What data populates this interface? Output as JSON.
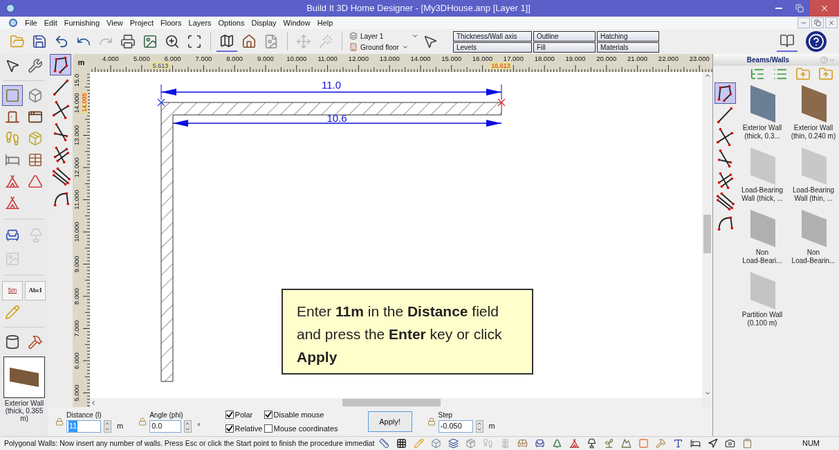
{
  "window": {
    "title": "Build It 3D Home Designer - [My3DHouse.anp [Layer 1]]"
  },
  "menu": [
    "File",
    "Edit",
    "Furnishing",
    "View",
    "Project",
    "Floors",
    "Layers",
    "Options",
    "Display",
    "Window",
    "Help"
  ],
  "toolbar": {
    "layer": "Layer 1",
    "floor": "Ground floor",
    "view_buttons": [
      "Thickness/Wall axis",
      "Outline",
      "Hatching",
      "Levels",
      "Fill",
      "Materials"
    ]
  },
  "toolbox": {
    "dimension_label": "5m",
    "text_label": "AbcI",
    "current_item": [
      "Exterior Wall",
      "(thick, 0.365",
      "m)"
    ]
  },
  "draw_tools": [
    {
      "selected": true
    },
    {
      "selected": false
    },
    {
      "selected": false
    },
    {
      "selected": false
    },
    {
      "selected": false
    },
    {
      "selected": false
    },
    {
      "selected": false
    }
  ],
  "rulers": {
    "unit": "m",
    "x_labels": [
      "4.000",
      "5.000",
      "6.000",
      "7.000",
      "8.000",
      "9.000",
      "10.000",
      "11.000",
      "12.000",
      "13.000",
      "14.000",
      "15.000",
      "16.000",
      "17.000",
      "18.000",
      "19.000",
      "20.000",
      "21.000",
      "22.000",
      "23.000"
    ],
    "y_labels": [
      "15.0",
      "14.000",
      "13.000",
      "12.000",
      "11.000",
      "10.000",
      "9.000",
      "8.000",
      "7.000",
      "6.000",
      "5.000"
    ],
    "x_start_marker": "5.613",
    "x_cursor": "16.613",
    "y_cursor": "14.095"
  },
  "drawing": {
    "outer_dimension": "11.0",
    "inner_dimension": "10.6"
  },
  "callout": "Enter **11m** in the **Distance** field and press the **Enter** key or click **Apply**",
  "input_bar": {
    "distance": {
      "label": "Distance (l)",
      "value": "11",
      "unit": "m"
    },
    "angle": {
      "label": "Angle (phi)",
      "value": "0.0",
      "unit": "°"
    },
    "checks": [
      {
        "label": "Polar",
        "checked": true
      },
      {
        "label": "Relative",
        "checked": true
      },
      {
        "label": "Disable mouse",
        "checked": true
      },
      {
        "label": "Mouse coordinates",
        "checked": false
      }
    ],
    "apply": "Apply!",
    "step": {
      "label": "Step",
      "value": "-0.050",
      "unit": "m"
    }
  },
  "right_panel": {
    "title": "Beams/Walls",
    "tools": [
      {
        "selected": true
      },
      {
        "selected": false
      },
      {
        "selected": false
      },
      {
        "selected": false
      },
      {
        "selected": false
      },
      {
        "selected": false
      },
      {
        "selected": false
      }
    ],
    "items": [
      {
        "lines": [
          "Exterior Wall",
          "(thick, 0.3..."
        ],
        "color": "#6a7f95"
      },
      {
        "lines": [
          "Exterior Wall",
          "(thin, 0.240 m)"
        ],
        "color": "#8a6a4a"
      },
      {
        "lines": [
          "Load-Bearing",
          "Wall (thick, ..."
        ],
        "color": "#c8c8c8"
      },
      {
        "lines": [
          "Load-Bearing",
          "Wall (thin, ..."
        ],
        "color": "#c8c8c8"
      },
      {
        "lines": [
          "Non",
          "Load-Beari..."
        ],
        "color": "#b0b0b0"
      },
      {
        "lines": [
          "Non",
          "Load-Bearin..."
        ],
        "color": "#b0b0b0"
      },
      {
        "lines": [
          "Partition Wall",
          "(0.100 m)"
        ],
        "color": "#c4c4c4"
      }
    ]
  },
  "status_bar": {
    "message": "Polygonal Walls: Now insert any number of walls. Press Esc or click the Start point to finish the procedure immediat",
    "indicator": "NUM"
  }
}
